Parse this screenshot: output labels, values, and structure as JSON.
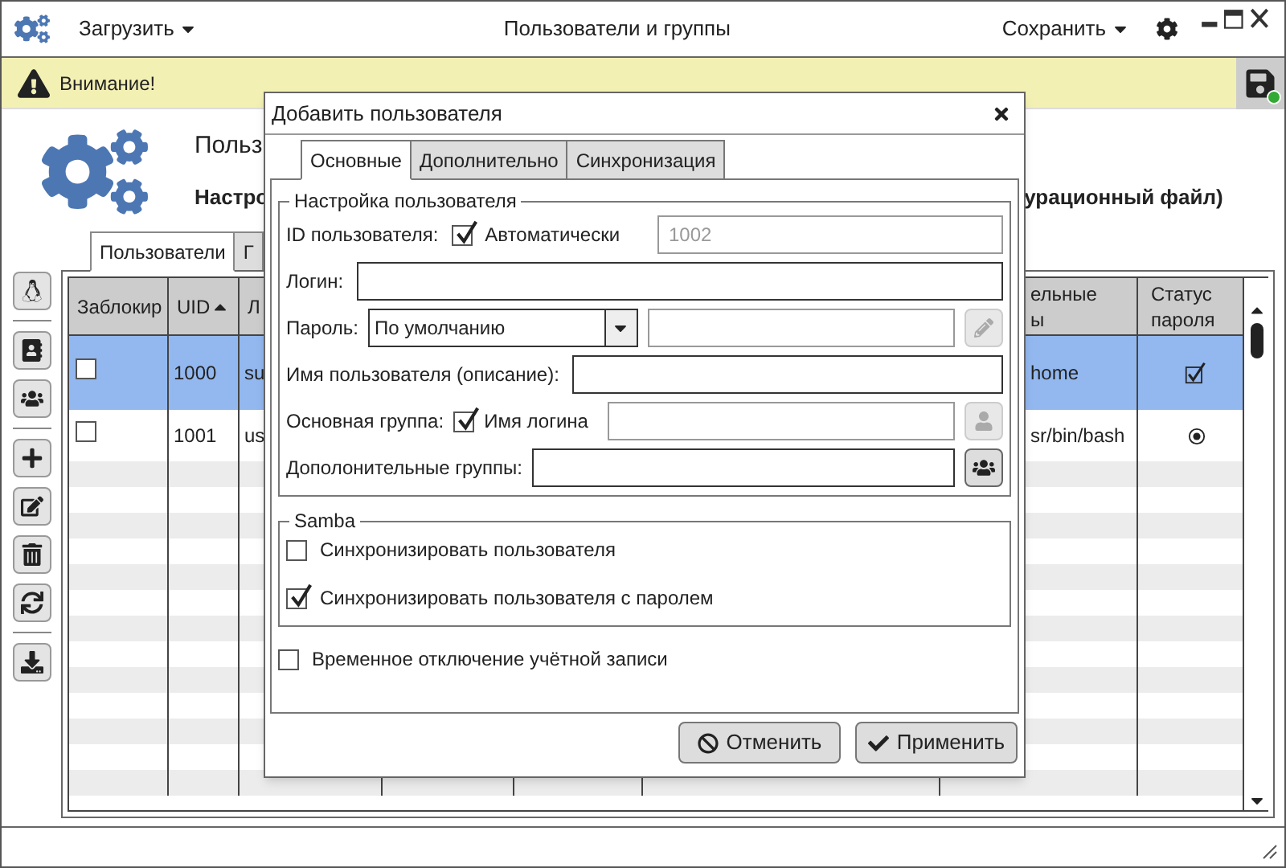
{
  "window": {
    "title": "Пользователи и группы",
    "menus": [
      {
        "label": "Загрузить"
      },
      {
        "label": "Сохранить"
      }
    ]
  },
  "warning": {
    "text": "Внимание!"
  },
  "header": {
    "title": "Польз",
    "subtitle_start": "Настро",
    "subtitle_end": "урационный файл)"
  },
  "tabs": [
    {
      "label": "Пользователи",
      "selected": true
    },
    {
      "label": "Г",
      "selected": false
    }
  ],
  "table": {
    "columns": [
      {
        "label": "Заблокир",
        "sorted": false
      },
      {
        "label": "UID",
        "sorted": true
      },
      {
        "label": "Л",
        "sorted": false
      },
      {
        "label": "ельные ы",
        "sorted": false
      },
      {
        "label": "Статус пароля",
        "sorted": false
      }
    ],
    "rows": [
      {
        "locked": false,
        "uid": "1000",
        "login": "su",
        "path": "home",
        "status": {
          "kind": "tick"
        },
        "selected": true
      },
      {
        "locked": false,
        "uid": "1001",
        "login": "us",
        "path": "sr/bin/bash",
        "status": {
          "kind": "dot"
        },
        "selected": false
      }
    ]
  },
  "dialog": {
    "title": "Добавить пользователя",
    "tabs": [
      {
        "label": "Основные",
        "selected": true
      },
      {
        "label": "Дополнительно",
        "selected": false
      },
      {
        "label": "Синхронизация",
        "selected": false
      }
    ],
    "settings": {
      "legend": "Настройка пользователя",
      "uid_label": "ID пользователя:",
      "auto": {
        "label": "Автоматически",
        "checked": true
      },
      "uid_value": "1002",
      "login_label": "Логин:",
      "password_label": "Пароль:",
      "password_mode": "По умолчанию",
      "password_edit_disabled": true,
      "name_label": "Имя пользователя (описание):",
      "group_label": "Основная группа:",
      "group_auto": {
        "label": "Имя логина",
        "checked": true
      },
      "extra_groups_label": "Дополонительные группы:"
    },
    "samba": {
      "legend": "Samba",
      "options": [
        {
          "label": "Синхронизировать пользователя",
          "checked": false
        },
        {
          "label": "Синхронизировать пользователя с паролем",
          "checked": true
        }
      ]
    },
    "disable_account": {
      "label": "Временное отключение учётной записи",
      "checked": false
    },
    "buttons": [
      {
        "label": "Отменить",
        "kind": "cancel"
      },
      {
        "label": "Применить",
        "kind": "apply"
      }
    ]
  }
}
